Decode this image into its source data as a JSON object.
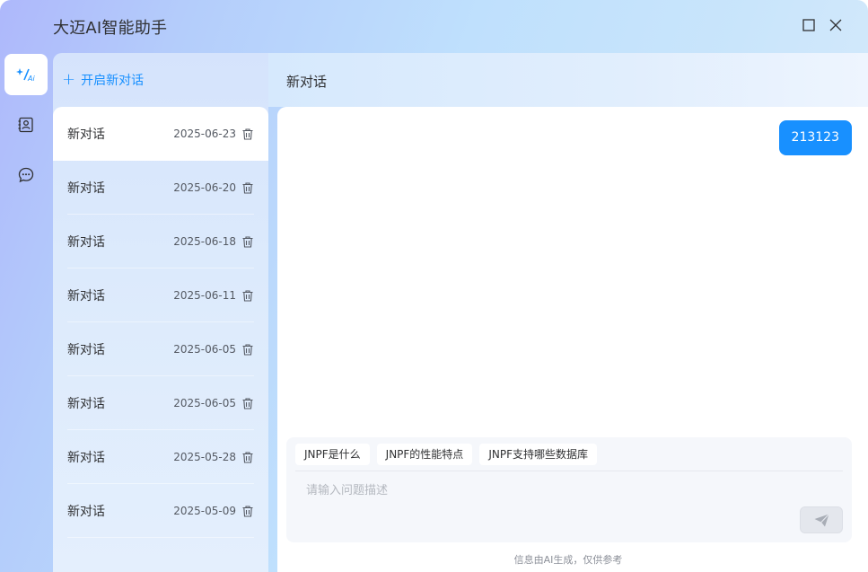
{
  "window": {
    "title": "大迈AI智能助手",
    "icons": [
      "maximize-icon",
      "close-icon"
    ]
  },
  "rail": {
    "items": [
      {
        "icon": "ai-sparkle-icon",
        "active": true
      },
      {
        "icon": "contact-card-icon",
        "active": false
      },
      {
        "icon": "chat-bubble-icon",
        "active": false
      }
    ]
  },
  "sidebar": {
    "new_chat_label": "开启新对话",
    "conversations": [
      {
        "title": "新对话",
        "date": "2025-06-23",
        "active": true
      },
      {
        "title": "新对话",
        "date": "2025-06-20",
        "active": false
      },
      {
        "title": "新对话",
        "date": "2025-06-18",
        "active": false
      },
      {
        "title": "新对话",
        "date": "2025-06-11",
        "active": false
      },
      {
        "title": "新对话",
        "date": "2025-06-05",
        "active": false
      },
      {
        "title": "新对话",
        "date": "2025-06-05",
        "active": false
      },
      {
        "title": "新对话",
        "date": "2025-05-28",
        "active": false
      },
      {
        "title": "新对话",
        "date": "2025-05-09",
        "active": false
      }
    ]
  },
  "chat": {
    "title": "新对话",
    "messages": [
      {
        "role": "user",
        "text": "213123"
      }
    ],
    "suggestions": [
      "JNPF是什么",
      "JNPF的性能特点",
      "JNPF支持哪些数据库"
    ],
    "input_placeholder": "请输入问题描述",
    "input_value": "",
    "disclaimer": "信息由AI生成，仅供参考"
  },
  "colors": {
    "accent": "#1890ff",
    "send_button_bg": "#e4e7ed"
  }
}
